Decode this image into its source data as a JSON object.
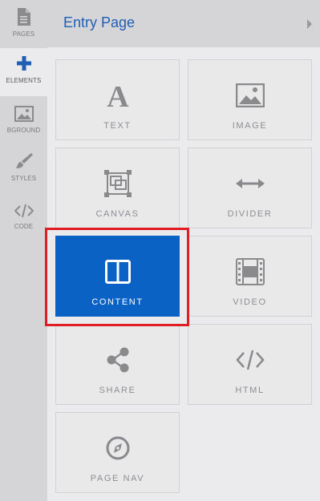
{
  "header": {
    "title": "Entry Page"
  },
  "rail": {
    "items": [
      {
        "label": "PAGES",
        "icon": "pages-icon"
      },
      {
        "label": "ELEMENTS",
        "icon": "plus-icon"
      },
      {
        "label": "BGROUND",
        "icon": "image-icon"
      },
      {
        "label": "STYLES",
        "icon": "brush-icon"
      },
      {
        "label": "CODE",
        "icon": "code-icon"
      }
    ]
  },
  "tiles": [
    {
      "label": "TEXT",
      "icon": "text-icon"
    },
    {
      "label": "IMAGE",
      "icon": "image-icon"
    },
    {
      "label": "CANVAS",
      "icon": "canvas-icon"
    },
    {
      "label": "DIVIDER",
      "icon": "divider-icon"
    },
    {
      "label": "CONTENT",
      "icon": "columns-icon"
    },
    {
      "label": "VIDEO",
      "icon": "film-icon"
    },
    {
      "label": "SHARE",
      "icon": "share-icon"
    },
    {
      "label": "HTML",
      "icon": "code-icon"
    },
    {
      "label": "PAGE NAV",
      "icon": "compass-icon"
    }
  ],
  "colors": {
    "accent": "#0a62c4",
    "highlight": "#e11d24",
    "title": "#1f5fb4"
  }
}
